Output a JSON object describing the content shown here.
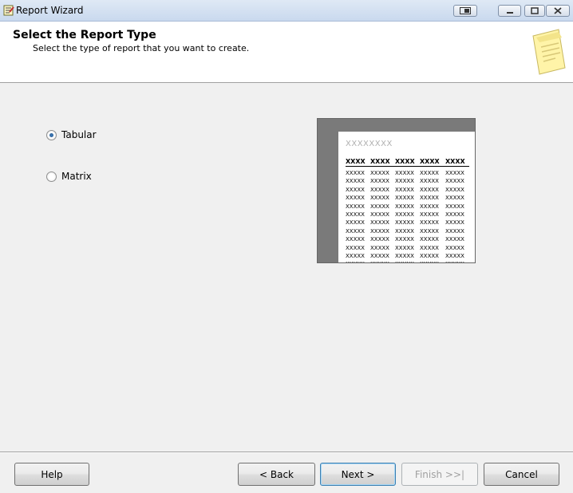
{
  "window": {
    "title": "Report Wizard",
    "icon": "report-wizard-icon"
  },
  "header": {
    "title": "Select the Report Type",
    "subtitle": "Select the type of report that you want to create.",
    "icon": "report-page-icon"
  },
  "options": {
    "tabular": {
      "label": "Tabular",
      "checked": true
    },
    "matrix": {
      "label": "Matrix",
      "checked": false
    }
  },
  "preview": {
    "title_placeholder": "XXXXXXXX",
    "header_cells": [
      "XXXX",
      "XXXX",
      "XXXX",
      "XXXX",
      "XXXX"
    ],
    "cell_text": "XXXXX",
    "row_count": 12
  },
  "buttons": {
    "help": "Help",
    "back": "< Back",
    "next": "Next >",
    "finish": "Finish >>|",
    "cancel": "Cancel"
  },
  "colors": {
    "titlebar": "#c9d9ee",
    "header_bg": "#ffffff",
    "body_bg": "#f0f0f0",
    "preview_frame": "#7a7a7a"
  }
}
